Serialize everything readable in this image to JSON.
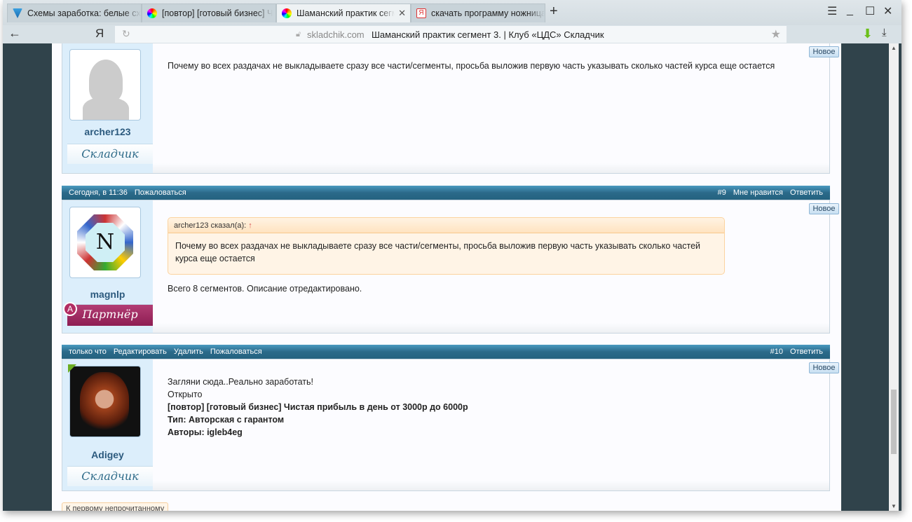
{
  "browser": {
    "tabs": [
      {
        "title": "Схемы заработка: белые схе",
        "icon": "vk-tab-icon",
        "active": false
      },
      {
        "title": "[повтор] [готовый бизнес] Ч",
        "icon": "colorwheel-tab-icon",
        "active": false
      },
      {
        "title": "Шаманский практик сегм",
        "icon": "colorwheel-tab-icon",
        "active": true
      },
      {
        "title": "скачать программу ножница",
        "icon": "yandex-tab-icon",
        "active": false
      }
    ],
    "yandex_logo": "Я",
    "domain": "skladchik.com",
    "page_title": "Шаманский практик сегмент 3. | Клуб «ЦДС» Складчик"
  },
  "posts": [
    {
      "user": "archer123",
      "rank": "Складчик",
      "text": "Почему во всех раздачах не выкладываете сразу все части/сегменты, просьба выложив первую часть указывать сколько частей курса еще остается",
      "new_label": "Новое"
    },
    {
      "header_left": [
        "Сегодня, в 11:36",
        "Пожаловаться"
      ],
      "header_right": [
        "#9",
        "Мне нравится",
        "Ответить"
      ],
      "user": "magnlp",
      "rank": "Партнёр",
      "badge": "A",
      "quote_author": "archer123 сказал(а):",
      "quote_arrow": "↑",
      "quote_text": "Почему во всех раздачах не выкладываете сразу все части/сегменты, просьба выложив первую часть указывать сколько частей курса еще остается",
      "text": "Всего 8 сегментов. Описание отредактировано.",
      "new_label": "Новое"
    },
    {
      "header_left": [
        "только что",
        "Редактировать",
        "Удалить",
        "Пожаловаться"
      ],
      "header_right": [
        "#10",
        "Ответить"
      ],
      "user": "Adigey",
      "rank": "Складчик",
      "lines": [
        "Загляни сюда..Реально заработать!",
        "Открыто"
      ],
      "bold_lines": [
        "[повтор] [готовый бизнес] Чистая прибыль в день от 3000р до 6000р",
        "Тип: Авторская с гарантом",
        "Авторы: igleb4eg"
      ],
      "new_label": "Новое"
    }
  ],
  "unread_button": "К первому непрочитанному"
}
